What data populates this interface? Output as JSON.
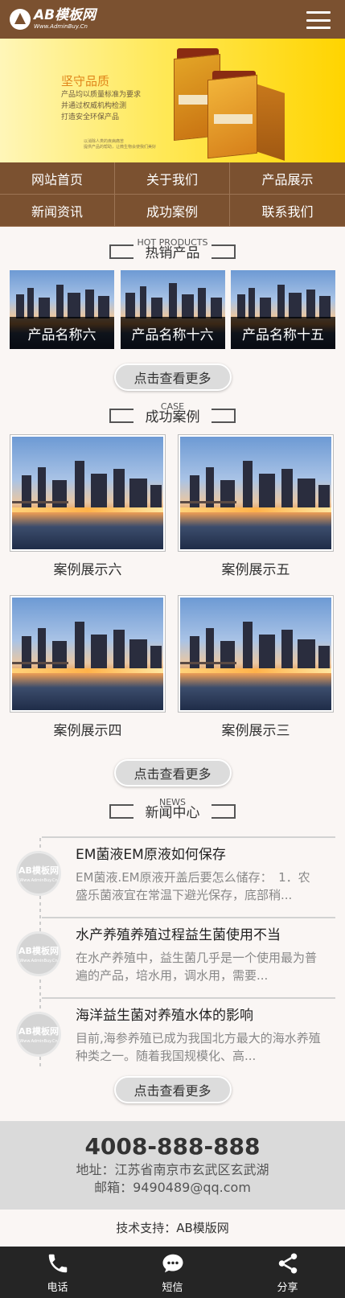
{
  "header": {
    "logo_title": "AB模板网",
    "logo_sub": "Www.AdminBuy.Cn",
    "menu_icon": "hamburger-menu-icon"
  },
  "banner": {
    "headline": "坚守品质",
    "lines": [
      "产品均以质量标准为要求",
      "并通过权威机构检测",
      "打造安全环保产品"
    ],
    "small": [
      "以消除人类的疾病痛苦",
      "提供产品的帮助，让微生物会使我们美好"
    ]
  },
  "nav": [
    "网站首页",
    "关于我们",
    "产品展示",
    "新闻资讯",
    "成功案例",
    "联系我们"
  ],
  "products": {
    "en": "HOT PRODUCTS",
    "cn": "热销产品",
    "items": [
      "产品名称六",
      "产品名称十六",
      "产品名称十五"
    ],
    "more": "点击查看更多"
  },
  "cases": {
    "en": "CASE",
    "cn": "成功案例",
    "items": [
      "案例展示六",
      "案例展示五",
      "案例展示四",
      "案例展示三"
    ],
    "more": "点击查看更多"
  },
  "news": {
    "en": "NEWS",
    "cn": "新闻中心",
    "thumb_text": "AB模板网",
    "thumb_sub": "Www.AdminBuy.Cn",
    "items": [
      {
        "title": "EM菌液EM原液如何保存",
        "desc": "EM菌液.EM原液开盖后要怎么储存：　1．农盛乐菌液宜在常温下避光保存，底部稍..."
      },
      {
        "title": "水产养殖养殖过程益生菌使用不当",
        "desc": "在水产养殖中，益生菌几乎是一个使用最为普遍的产品，培水用，调水用，需要..."
      },
      {
        "title": "海洋益生菌对养殖水体的影响",
        "desc": "目前,海参养殖已成为我国北方最大的海水养殖种类之一。随着我国规模化、高..."
      }
    ],
    "more": "点击查看更多"
  },
  "footer": {
    "phone": "4008-888-888",
    "address": "地址：江苏省南京市玄武区玄武湖",
    "email": "邮箱：9490489@qq.com",
    "support": "技术支持：AB模版网"
  },
  "bottom_bar": [
    {
      "label": "电话",
      "icon": "phone-icon"
    },
    {
      "label": "短信",
      "icon": "message-icon"
    },
    {
      "label": "分享",
      "icon": "share-icon"
    }
  ]
}
